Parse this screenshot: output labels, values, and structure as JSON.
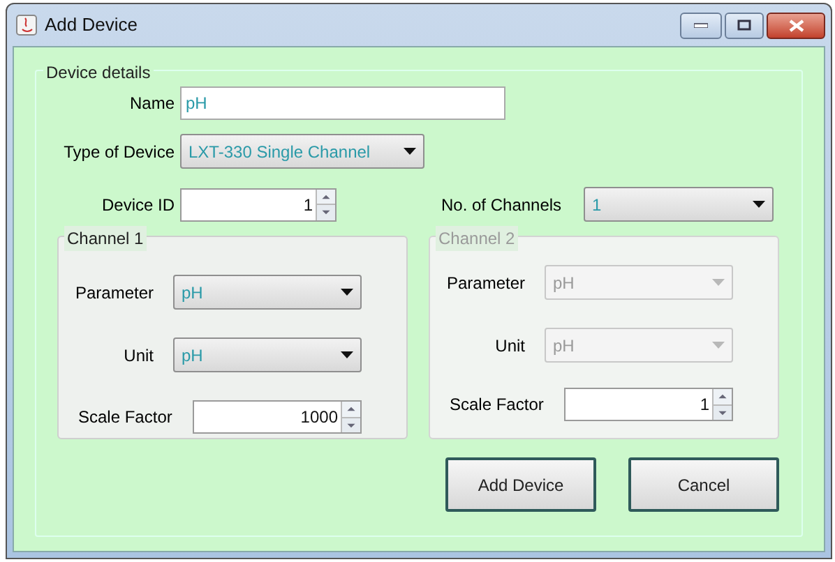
{
  "window": {
    "title": "Add Device"
  },
  "device_details": {
    "title": "Device details",
    "name": {
      "label": "Name",
      "value": "pH"
    },
    "type": {
      "label": "Type of Device",
      "value": "LXT-330 Single Channel"
    },
    "device_id": {
      "label": "Device ID",
      "value": "1"
    },
    "channel_count": {
      "label": "No. of Channels",
      "value": "1"
    }
  },
  "channels": [
    {
      "title": "Channel 1",
      "disabled": false,
      "parameter": {
        "label": "Parameter",
        "value": "pH"
      },
      "unit": {
        "label": "Unit",
        "value": "pH"
      },
      "scale_factor": {
        "label": "Scale Factor",
        "value": "1000"
      }
    },
    {
      "title": "Channel 2",
      "disabled": true,
      "parameter": {
        "label": "Parameter",
        "value": "pH"
      },
      "unit": {
        "label": "Unit",
        "value": "pH"
      },
      "scale_factor": {
        "label": "Scale Factor",
        "value": "1"
      }
    }
  ],
  "buttons": [
    "Add Device",
    "Cancel"
  ]
}
